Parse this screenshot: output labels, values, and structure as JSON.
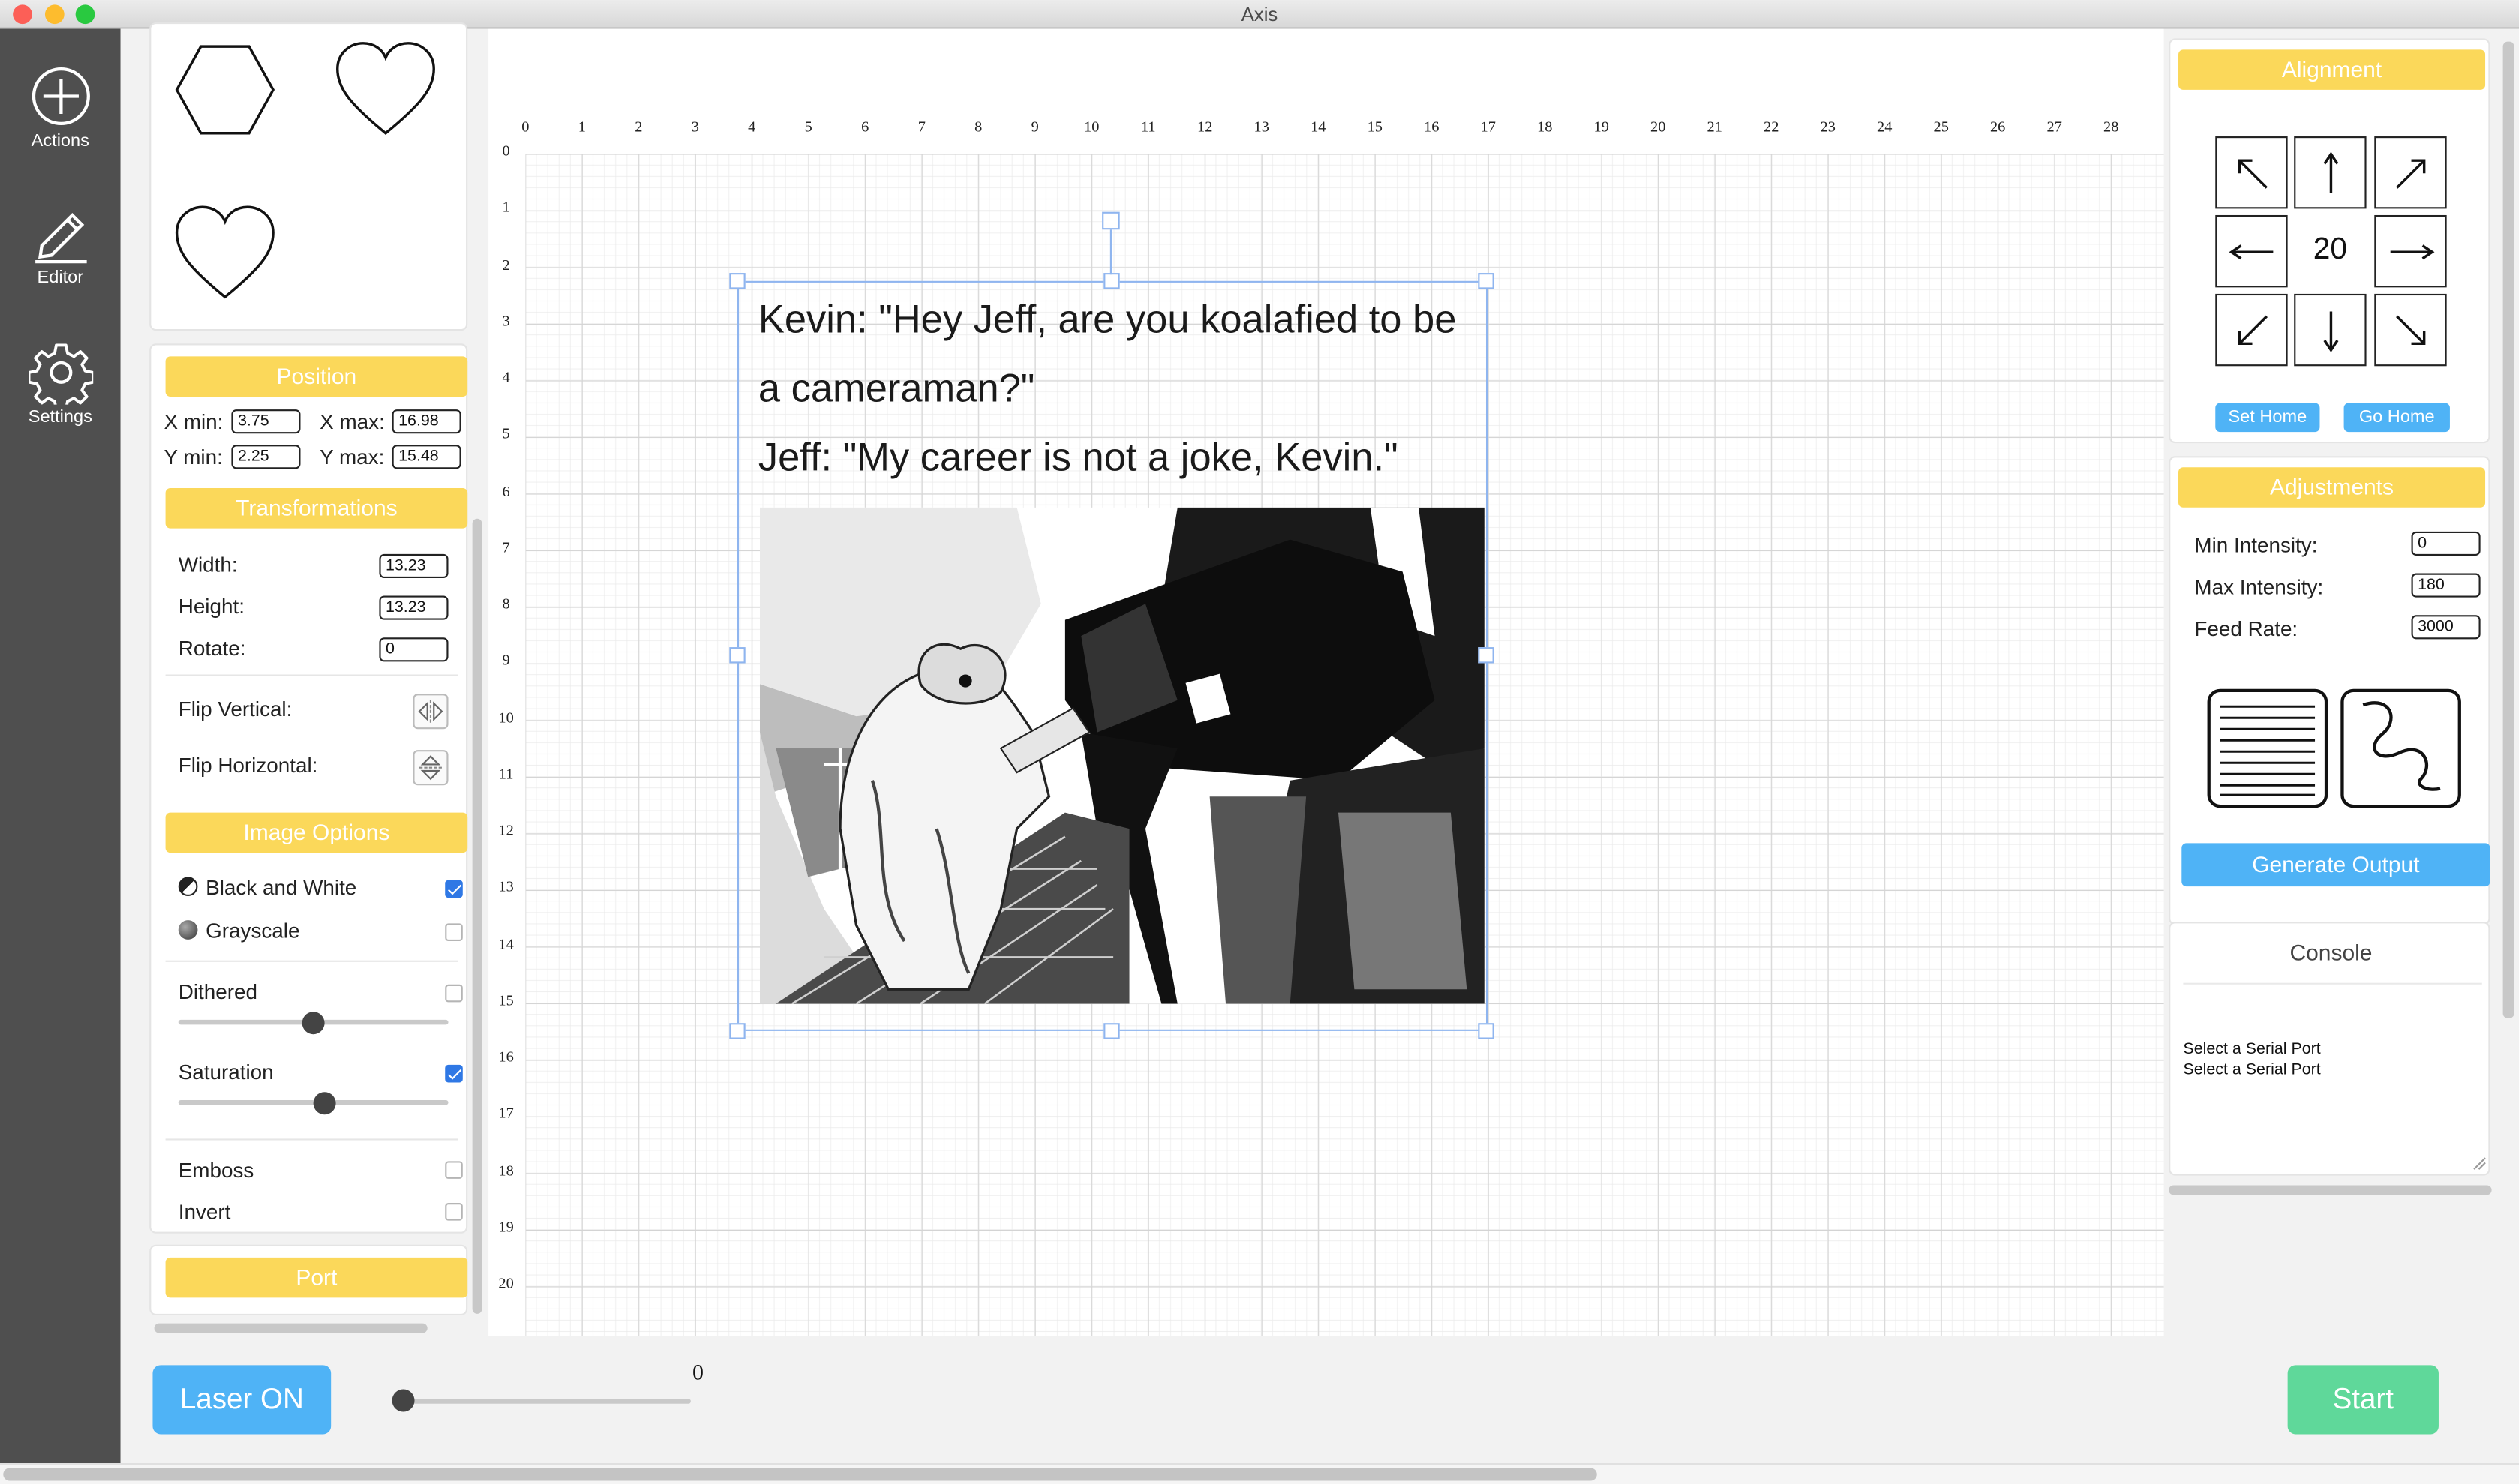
{
  "window": {
    "title": "Axis"
  },
  "nav": [
    {
      "label": "Actions",
      "icon": "plus-circle-icon"
    },
    {
      "label": "Editor",
      "icon": "pencil-icon"
    },
    {
      "label": "Settings",
      "icon": "gear-icon"
    }
  ],
  "shapes": [
    "hexagon-shape",
    "heart-shape",
    "heart-shape"
  ],
  "position": {
    "title": "Position",
    "xmin_label": "X min:",
    "xmin": "3.75",
    "xmax_label": "X max:",
    "xmax": "16.98",
    "ymin_label": "Y min:",
    "ymin": "2.25",
    "ymax_label": "Y max:",
    "ymax": "15.48"
  },
  "transformations": {
    "title": "Transformations",
    "width_label": "Width:",
    "width": "13.23",
    "height_label": "Height:",
    "height": "13.23",
    "rotate_label": "Rotate:",
    "rotate": "0",
    "flip_vertical_label": "Flip Vertical:",
    "flip_horizontal_label": "Flip Horizontal:"
  },
  "image_options": {
    "title": "Image Options",
    "bw_label": "Black and White",
    "bw_checked": true,
    "grayscale_label": "Grayscale",
    "grayscale_checked": false,
    "dithered_label": "Dithered",
    "dithered_checked": false,
    "dithered_level": 0.5,
    "saturation_label": "Saturation",
    "saturation_checked": true,
    "saturation_level": 0.54,
    "emboss_label": "Emboss",
    "emboss_checked": false,
    "invert_label": "Invert",
    "invert_checked": false
  },
  "port": {
    "title": "Port"
  },
  "canvas": {
    "x_ticks": [
      "0",
      "1",
      "2",
      "3",
      "4",
      "5",
      "6",
      "7",
      "8",
      "9",
      "10",
      "11",
      "12",
      "13",
      "14",
      "15",
      "16",
      "17",
      "18",
      "19",
      "20",
      "21",
      "22",
      "23",
      "24",
      "25",
      "26",
      "27",
      "28"
    ],
    "y_ticks": [
      "0",
      "1",
      "2",
      "3",
      "4",
      "5",
      "6",
      "7",
      "8",
      "9",
      "10",
      "11",
      "12",
      "13",
      "14",
      "15",
      "16",
      "17",
      "18",
      "19",
      "20"
    ],
    "caption_line1": "Kevin: \"Hey Jeff, are you koalafied to be",
    "caption_line2": "a cameraman?\"",
    "caption_line3": "Jeff: \"My career is not a joke, Kevin.\""
  },
  "alignment": {
    "title": "Alignment",
    "step": "20",
    "set_home": "Set Home",
    "go_home": "Go Home"
  },
  "adjustments": {
    "title": "Adjustments",
    "min_label": "Min Intensity:",
    "min": "0",
    "max_label": "Max Intensity:",
    "max": "180",
    "feed_label": "Feed Rate:",
    "feed": "3000",
    "generate": "Generate Output"
  },
  "console": {
    "title": "Console",
    "lines": [
      "Select a Serial Port",
      "Select a Serial Port"
    ]
  },
  "bottom": {
    "laser": "Laser ON",
    "power_value": "0",
    "start": "Start"
  },
  "colors": {
    "accent_yellow": "#fbd85a",
    "blue": "#4fb3f6",
    "green": "#5fd89a",
    "nav": "#4f4f4f"
  }
}
